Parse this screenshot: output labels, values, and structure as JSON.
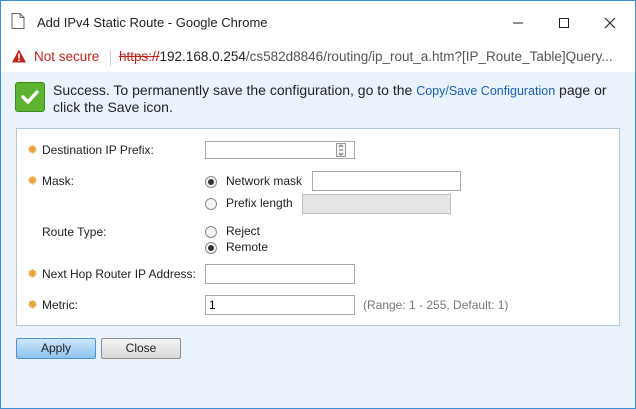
{
  "window": {
    "title": "Add IPv4 Static Route - Google Chrome",
    "minimize_icon": "minimize-icon",
    "maximize_icon": "maximize-icon",
    "close_icon": "close-icon"
  },
  "addressbar": {
    "security_label": "Not secure",
    "url_scheme": "https://",
    "url_host": "192.168.0.254",
    "url_path": "/cs582d8846/routing/ip_rout_a.htm?[IP_Route_Table]Query..."
  },
  "success": {
    "text_before": "Success. To permanently save the configuration, go to the ",
    "link_text": "Copy/Save Configuration",
    "text_after": " page or click the Save icon."
  },
  "form": {
    "dest_prefix_label": "Destination IP Prefix:",
    "dest_prefix_value": "",
    "mask_label": "Mask:",
    "network_mask_label": "Network mask",
    "network_mask_value": "",
    "prefix_length_label": "Prefix length",
    "prefix_length_value": "",
    "route_type_label": "Route Type:",
    "reject_label": "Reject",
    "remote_label": "Remote",
    "next_hop_label": "Next Hop Router IP Address:",
    "next_hop_value": "",
    "metric_label": "Metric:",
    "metric_value": "1",
    "metric_hint": "(Range: 1 - 255, Default: 1)"
  },
  "buttons": {
    "apply": "Apply",
    "close": "Close"
  },
  "colors": {
    "required_star": "#e8a33c",
    "not_secure": "#c5221f",
    "link": "#1a5fb4",
    "success_check": "#5cb32f"
  }
}
